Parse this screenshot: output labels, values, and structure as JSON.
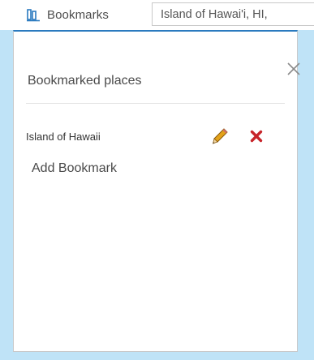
{
  "toolbar": {
    "bookmarks_tab_label": "Bookmarks",
    "bookmarks_icon": "bookmark-icon",
    "search": {
      "value": "Island of Hawai'i, HI,",
      "placeholder": ""
    }
  },
  "panel": {
    "title": "Bookmarked places",
    "close_icon": "close-icon",
    "bookmarks": [
      {
        "name": "Island of Hawaii",
        "edit_icon": "pencil-icon",
        "delete_icon": "delete-icon"
      }
    ],
    "add_label": "Add Bookmark"
  },
  "colors": {
    "accent": "#2a7abf",
    "panel_background": "#bfe3f7",
    "delete_red": "#c7242a"
  }
}
